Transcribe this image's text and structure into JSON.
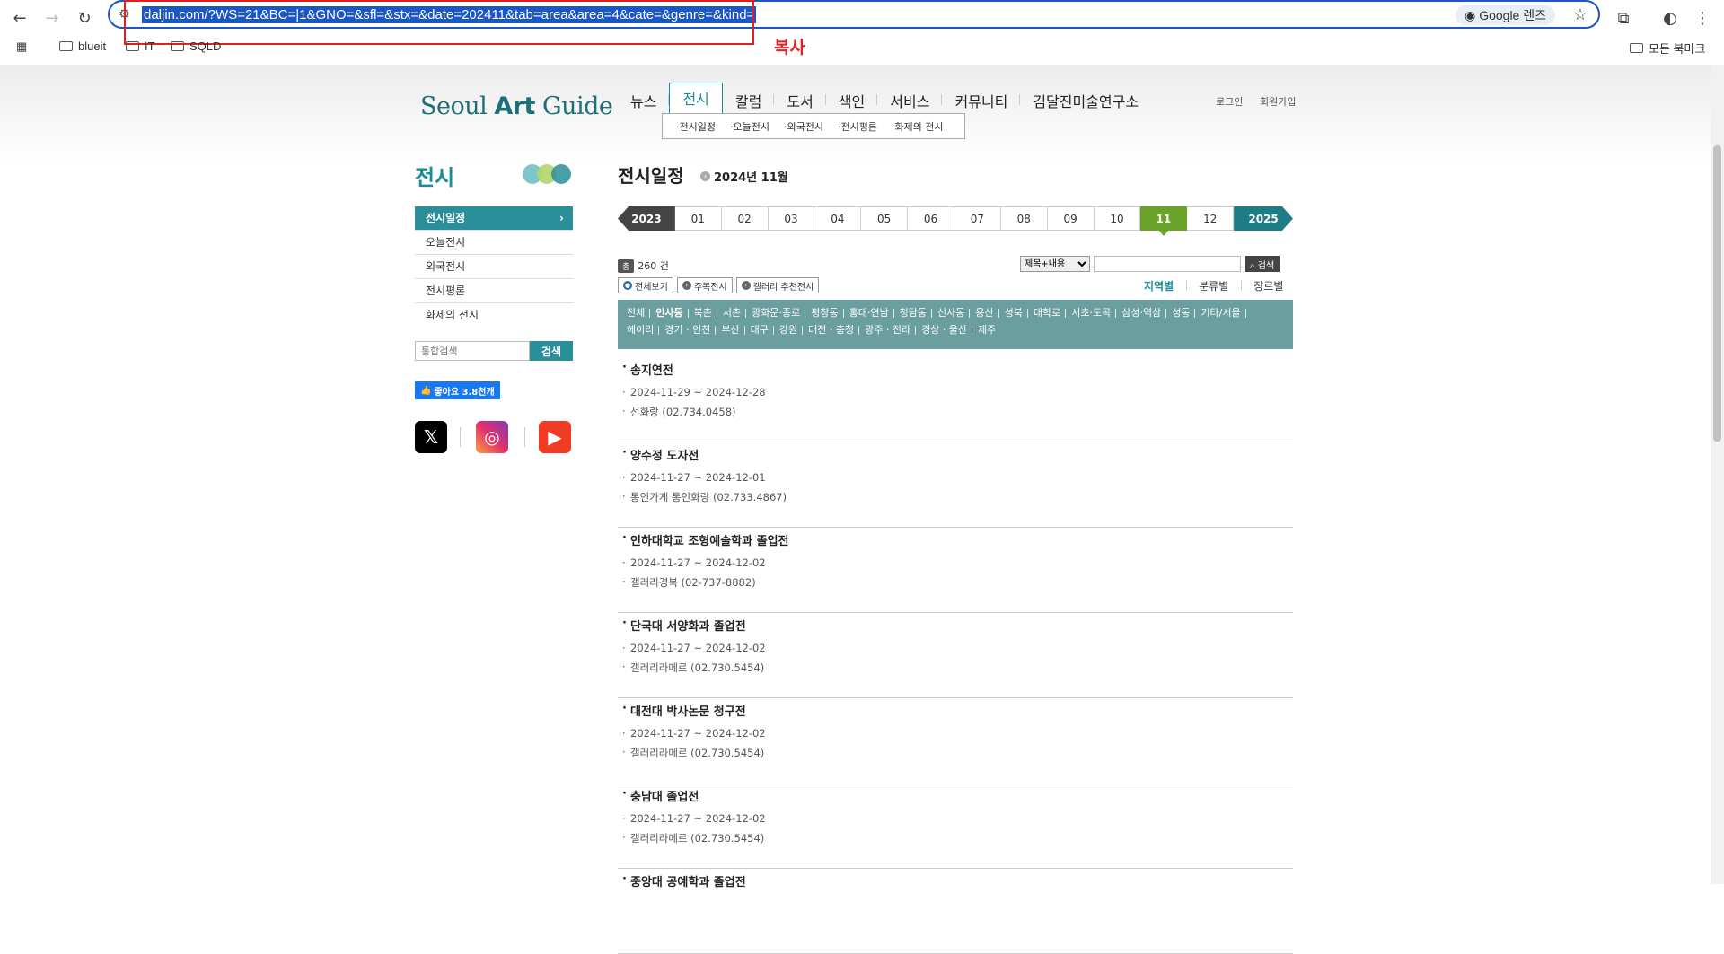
{
  "browser": {
    "url": "daljin.com/?WS=21&BC=|1&GNO=&sfl=&stx=&date=202411&tab=area&area=4&cate=&genre=&kind=",
    "lens_label": "Google 렌즈",
    "annotation_label": "복사",
    "bookmarks": [
      "blueit",
      "IT",
      "SQLD"
    ],
    "all_bookmarks": "모든 북마크"
  },
  "site": {
    "logo_light": "Seoul ",
    "logo_bold": "Art",
    "logo_tail": " Guide",
    "gnb": [
      "뉴스",
      "전시",
      "칼럼",
      "도서",
      "색인",
      "서비스",
      "커뮤니티",
      "김달진미술연구소"
    ],
    "sub_menu": [
      "·전시일정",
      "·오늘전시",
      "·외국전시",
      "·전시평론",
      "·화제의 전시"
    ],
    "login": "로그인",
    "signup": "회원가입"
  },
  "sidebar": {
    "title": "전시",
    "items": [
      "전시일정",
      "오늘전시",
      "외국전시",
      "전시평론",
      "화제의 전시"
    ],
    "search_placeholder": "통합검색",
    "search_button": "검색",
    "fb_like": "좋아요 3.8천개"
  },
  "content": {
    "title": "전시일정",
    "date": "2024년 11월",
    "prev_year": "2023",
    "next_year": "2025",
    "months": [
      "01",
      "02",
      "03",
      "04",
      "05",
      "06",
      "07",
      "08",
      "09",
      "10",
      "11",
      "12"
    ],
    "active_month": "11",
    "count_tag": "총",
    "count": "260 건",
    "search_select": "제목+내용",
    "search_button": "검색",
    "filters": [
      "전체보기",
      "주목전시",
      "갤러리 추천전시"
    ],
    "tabs": [
      "지역별",
      "분류별",
      "장르별"
    ],
    "regions": [
      "전체",
      "인사동",
      "북촌",
      "서촌",
      "광화문·종로",
      "평창동",
      "홍대·연남",
      "청담동",
      "신사동",
      "용산",
      "성북",
      "대학로",
      "서초·도곡",
      "삼성·역삼",
      "성동",
      "기타/서울",
      "헤이리",
      "경기 · 인천",
      "부산",
      "대구",
      "강원",
      "대전 · 충청",
      "광주 · 전라",
      "경상 · 울산",
      "제주"
    ],
    "active_region": "인사동",
    "exhibitions": [
      {
        "title": "송지연전",
        "period": "2024-11-29 ~ 2024-12-28",
        "venue": "선화랑 (02.734.0458)"
      },
      {
        "title": "양수정 도자전",
        "period": "2024-11-27 ~ 2024-12-01",
        "venue": "통인가게 통인화랑 (02.733.4867)"
      },
      {
        "title": "인하대학교 조형예술학과 졸업전",
        "period": "2024-11-27 ~ 2024-12-02",
        "venue": "갤러리경북 (02-737-8882)"
      },
      {
        "title": "단국대 서양화과 졸업전",
        "period": "2024-11-27 ~ 2024-12-02",
        "venue": "갤러리라메르 (02.730.5454)"
      },
      {
        "title": "대전대 박사논문 청구전",
        "period": "2024-11-27 ~ 2024-12-02",
        "venue": "갤러리라메르 (02.730.5454)"
      },
      {
        "title": "충남대 졸업전",
        "period": "2024-11-27 ~ 2024-12-02",
        "venue": "갤러리라메르 (02.730.5454)"
      },
      {
        "title": "중앙대 공예학과 졸업전",
        "period": "",
        "venue": ""
      }
    ]
  }
}
